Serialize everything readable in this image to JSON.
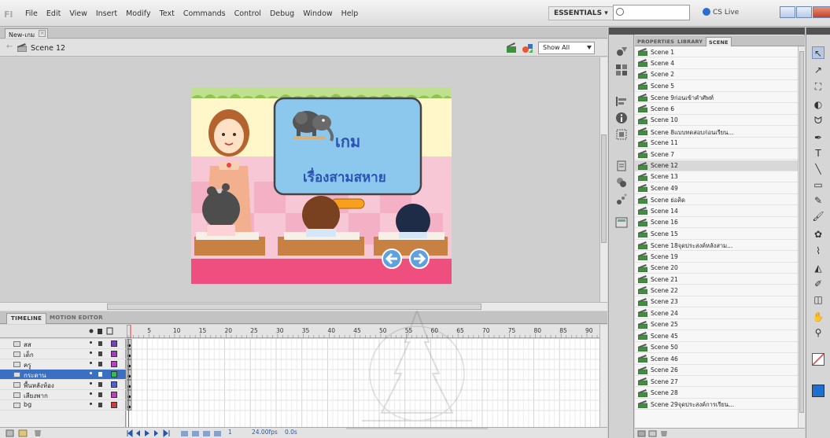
{
  "menu": [
    "File",
    "Edit",
    "View",
    "Insert",
    "Modify",
    "Text",
    "Commands",
    "Control",
    "Debug",
    "Window",
    "Help"
  ],
  "workspace_label": "ESSENTIALS ▾",
  "cs_live": "CS Live",
  "document_tab": "New-เกม",
  "scene_name": "Scene 12",
  "zoom": "Show All",
  "stage": {
    "title": "เกม",
    "subtitle": "เรื่องสามสหาย"
  },
  "timeline": {
    "tabs": [
      "TIMELINE",
      "MOTION EDITOR"
    ],
    "frame_numbers": [
      "5",
      "10",
      "15",
      "20",
      "25",
      "30",
      "35",
      "40",
      "45",
      "50",
      "55",
      "60",
      "65",
      "70",
      "75",
      "80",
      "85",
      "90"
    ],
    "layers": [
      {
        "name": "สส",
        "color": "#7b3fbf",
        "selected": false
      },
      {
        "name": "เด็ก",
        "color": "#a43bbf",
        "selected": false
      },
      {
        "name": "ครู",
        "color": "#c23bc7",
        "selected": false
      },
      {
        "name": "กระดาน",
        "color": "#2fbf4a",
        "selected": true
      },
      {
        "name": "พื้นหลังห้อง",
        "color": "#4a5fd9",
        "selected": false
      },
      {
        "name": "เสียงพาก",
        "color": "#c43bbf",
        "selected": false
      },
      {
        "name": "bg",
        "color": "#d23b3b",
        "selected": false
      }
    ],
    "current_frame": "1",
    "fps": "24.00fps",
    "time": "0.0s"
  },
  "panel_tabs": [
    "PROPERTIES",
    "LIBRARY",
    "SCENE"
  ],
  "scenes": [
    "Scene 1",
    "Scene 4",
    "Scene 2",
    "Scene 5",
    "Scene 9ก่อนเข้าคำศัพท์",
    "Scene 6",
    "Scene 10",
    "Scene 8แบบทดสอบก่อนเรียน...",
    "Scene 11",
    "Scene 7",
    "Scene 12",
    "Scene 13",
    "Scene 49",
    "Scene ย่อคิด",
    "Scene 14",
    "Scene 16",
    "Scene 15",
    "Scene 18จุดประสงค์หลังสาม...",
    "Scene 19",
    "Scene 20",
    "Scene 21",
    "Scene 22",
    "Scene 23",
    "Scene 24",
    "Scene 25",
    "Scene 45",
    "Scene 50",
    "Scene 46",
    "Scene 26",
    "Scene 27",
    "Scene 28",
    "Scene 29จุดประสงค์การเรียน..."
  ],
  "selected_scene": "Scene 12",
  "icons": {
    "scene": "scene-clapper-icon",
    "tools": [
      "selection-icon",
      "subselection-icon",
      "free-transform-icon",
      "3d-rotation-icon",
      "lasso-icon",
      "pen-icon",
      "text-icon",
      "line-icon",
      "rectangle-icon",
      "pencil-icon",
      "brush-icon",
      "deco-icon",
      "bone-icon",
      "paint-bucket-icon",
      "eyedropper-icon",
      "eraser-icon",
      "hand-icon",
      "zoom-icon"
    ]
  },
  "colors": {
    "selection": "#3a6fc1",
    "stroke_color": "#ff4c4c",
    "fill_color": "#1e6fd0"
  }
}
